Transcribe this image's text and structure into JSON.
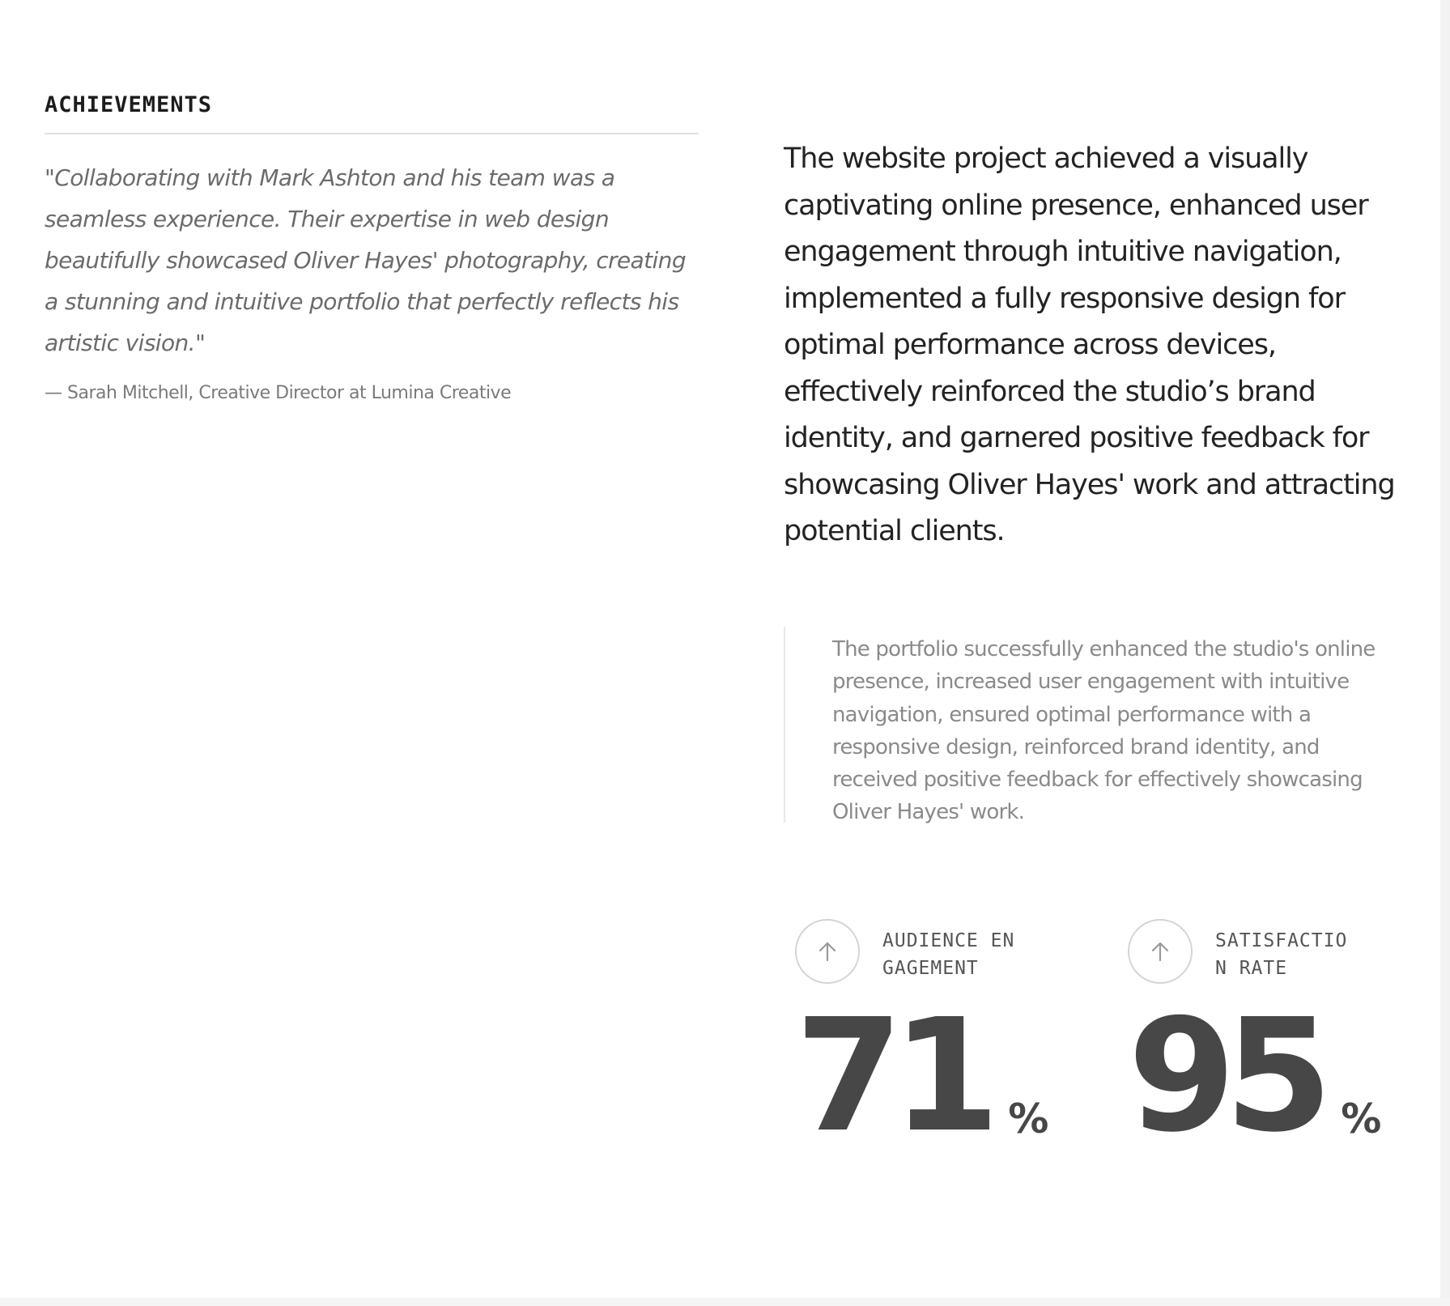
{
  "achievements": {
    "label": "ACHIEVEMENTS",
    "quote": "\"Collaborating with Mark Ashton and his team was a seamless experience. Their expertise in web design beautifully showcased Oliver Hayes' photography, creating a stunning and intuitive portfolio that perfectly reflects his artistic vision.\"",
    "attribution": "— Sarah Mitchell, Creative Director at Lumina Creative"
  },
  "summary": {
    "text": "The website project achieved a visually captivating online presence, enhanced user engagement through intuitive navigation, implemented a fully responsive design for optimal performance across devices, effectively reinforced the studio’s brand identity, and garnered positive feedback for showcasing Oliver Hayes' work and attracting potential clients.",
    "note": "The portfolio successfully enhanced the studio's online presence, increased user engagement with intuitive navigation, ensured optimal performance with a responsive design, reinforced brand identity, and received positive feedback for effectively showcasing Oliver Hayes' work."
  },
  "stats": [
    {
      "label": "AUDIENCE ENGAGEMENT",
      "value": "71",
      "unit": "%",
      "icon": "arrow-up-icon"
    },
    {
      "label": "SATISFACTION RATE",
      "value": "95",
      "unit": "%",
      "icon": "arrow-up-icon"
    }
  ],
  "colors": {
    "background": "#ffffff",
    "heading": "#1c1c1c",
    "quote": "#6b6b6b",
    "note": "#8a8a8a",
    "stat_number": "#474747",
    "divider": "#e2e2e2"
  }
}
